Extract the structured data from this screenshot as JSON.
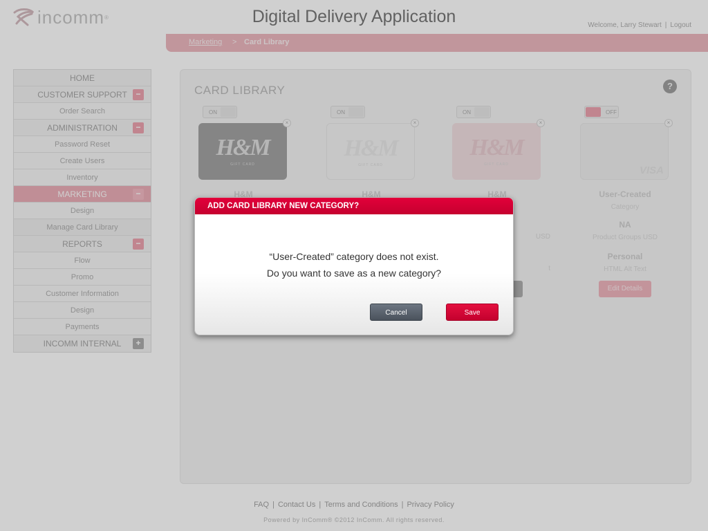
{
  "header": {
    "logo_text": "incomm",
    "logo_reg": "®",
    "title": "Digital Delivery Application",
    "welcome": "Welcome, Larry Stewart",
    "logout": "Logout"
  },
  "breadcrumb": {
    "parent": "Marketing",
    "separator": ">",
    "current": "Card Library"
  },
  "sidebar": {
    "home": "HOME",
    "customer_support": {
      "label": "CUSTOMER SUPPORT",
      "toggle": "−",
      "items": [
        "Order Search"
      ]
    },
    "administration": {
      "label": "ADMINISTRATION",
      "toggle": "−",
      "items": [
        "Password Reset",
        "Create Users",
        "Inventory"
      ]
    },
    "marketing": {
      "label": "MARKETING",
      "toggle": "−",
      "items": [
        "Design",
        "Manage Card Library"
      ]
    },
    "reports": {
      "label": "REPORTS",
      "toggle": "−",
      "items": [
        "Flow",
        "Promo",
        "Customer Information",
        "Design",
        "Payments"
      ]
    },
    "incomm_internal": {
      "label": "INCOMM INTERNAL",
      "toggle": "+"
    }
  },
  "panel": {
    "title": "CARD LIBRARY",
    "help": "?",
    "cards": [
      {
        "toggle": "ON",
        "logo": "H&M",
        "sub": "GIFT CARD",
        "close": "×",
        "name": "H&M"
      },
      {
        "toggle": "ON",
        "logo": "H&M",
        "sub": "GIFT CARD",
        "close": "×",
        "name": "H&M"
      },
      {
        "toggle": "ON",
        "logo": "H&M",
        "sub": "GIFT CARD",
        "close": "×",
        "name": "H&M",
        "field_1": "USD",
        "field_2": "t"
      },
      {
        "toggle": "OFF",
        "visa": "VISA",
        "close": "×",
        "name": "User-Created",
        "category_label": "Category",
        "value_1": "NA",
        "label_1": "Product Groups USD",
        "value_2": "Personal",
        "label_2": "HTML Alt Text",
        "edit": "Edit Details"
      }
    ]
  },
  "modal": {
    "title": "ADD CARD LIBRARY NEW CATEGORY?",
    "line_1": "“User-Created” category does not exist.",
    "line_2": "Do you want to save as a new category?",
    "cancel": "Cancel",
    "save": "Save"
  },
  "footer": {
    "links": [
      "FAQ",
      "Contact Us",
      "Terms and Conditions",
      "Privacy Policy"
    ],
    "separator": "|",
    "copyright": "Powered by InComm® ©2012 InComm. All rights reserved."
  },
  "colors": {
    "accent_red": "#d40035",
    "nav_pink": "#e79aa6",
    "cancel_gray": "#5a626d"
  }
}
